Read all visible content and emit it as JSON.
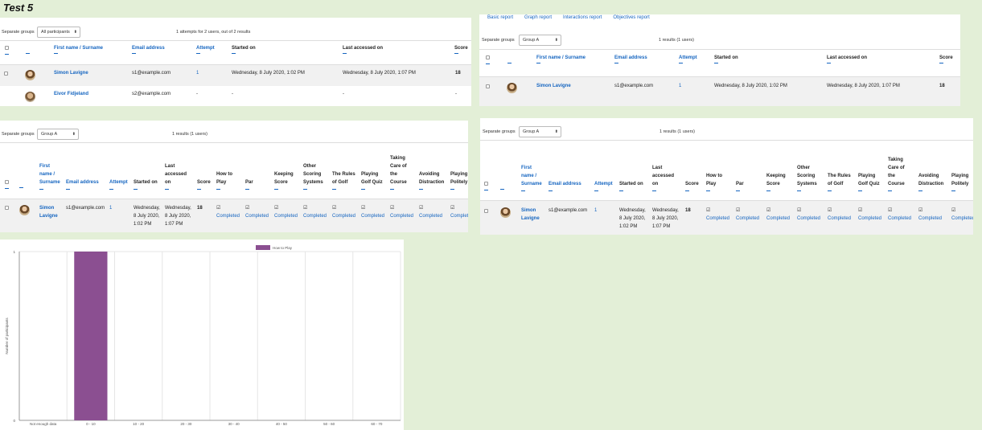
{
  "page_title": "Test 5",
  "p1": {
    "groups_label": "Separate groups",
    "groups_value": "All participants",
    "summary": "1 attempts for 2 users, out of 2 results",
    "headers": [
      "First name / Surname",
      "Email address",
      "Attempt",
      "Started on",
      "Last accessed on",
      "Score"
    ],
    "rows": [
      {
        "name": "Simon Lavigne",
        "email": "s1@example.com",
        "attempt": "1",
        "started": "Wednesday, 8 July 2020, 1:02 PM",
        "last": "Wednesday, 8 July 2020, 1:07 PM",
        "score": "18"
      },
      {
        "name": "Eivor Fidjeland",
        "email": "s2@example.com",
        "attempt": "-",
        "started": "-",
        "last": "-",
        "score": "-"
      }
    ]
  },
  "p2": {
    "tabs": [
      "Basic report",
      "Graph report",
      "Interactions report",
      "Objectives report"
    ],
    "groups_label": "Separate groups",
    "groups_value": "Group A",
    "summary": "1 results (1 users)",
    "headers": [
      "First name / Surname",
      "Email address",
      "Attempt",
      "Started on",
      "Last accessed on",
      "Score"
    ],
    "row": {
      "name": "Simon Lavigne",
      "email": "s1@example.com",
      "attempt": "1",
      "started": "Wednesday, 8 July 2020, 1:02 PM",
      "last": "Wednesday, 8 July 2020, 1:07 PM",
      "score": "18"
    }
  },
  "p3": {
    "groups_label": "Separate groups",
    "groups_value": "Group A",
    "summary": "1 results (1 users)",
    "headers": {
      "name": "First name / Surname",
      "email": "Email address",
      "attempt": "Attempt",
      "started": "Started on",
      "last": "Last accessed on",
      "score": "Score",
      "c1": "How to Play",
      "c2": "Par",
      "c3": "Keeping Score",
      "c4": "Other Scoring Systems",
      "c5": "The Rules of Golf",
      "c6": "Playing Golf Quiz",
      "c7": "Taking Care of the Course",
      "c8": "Avoiding Distraction",
      "c9": "Playing Politely"
    },
    "row": {
      "name": "Simon Lavigne",
      "email": "s1@example.com",
      "attempt": "1",
      "started": "Wednesday, 8 July 2020, 1:02 PM",
      "last": "Wednesday, 8 July 2020, 1:07 PM",
      "score": "18",
      "status": "Completed"
    }
  },
  "p4": {
    "groups_label": "Separate groups",
    "groups_value": "Group A",
    "summary": "1 results (1 users)",
    "headers": {
      "name": "First name / Surname",
      "email": "Email address",
      "attempt": "Attempt",
      "started": "Started on",
      "last": "Last accessed on",
      "score": "Score",
      "c1": "How to Play",
      "c2": "Par",
      "c3": "Keeping Score",
      "c4": "Other Scoring Systems",
      "c5": "The Rules of Golf",
      "c6": "Playing Golf Quiz",
      "c7": "Taking Care of the Course",
      "c8": "Avoiding Distraction",
      "c9": "Playing Politely"
    },
    "row": {
      "name": "Simon Lavigne",
      "email": "s1@example.com",
      "attempt": "1",
      "started": "Wednesday, 8 July 2020, 1:02 PM",
      "last": "Wednesday, 8 July 2020, 1:07 PM",
      "score": "18",
      "status": "Completed"
    }
  },
  "chart_data": {
    "type": "bar",
    "categories": [
      "Not enough data",
      "0 - 10",
      "10 - 20",
      "20 - 30",
      "30 - 40",
      "40 - 50",
      "50 - 60",
      "60 - 70"
    ],
    "series": [
      {
        "name": "How to Play",
        "values": [
          0,
          1,
          0,
          0,
          0,
          0,
          0,
          0
        ],
        "color": "#8b4f91"
      }
    ],
    "ylabel": "Number of participants",
    "ylim": [
      0,
      1
    ],
    "yticks": [
      "0",
      "1"
    ],
    "grid": true,
    "legend": "top-right"
  }
}
